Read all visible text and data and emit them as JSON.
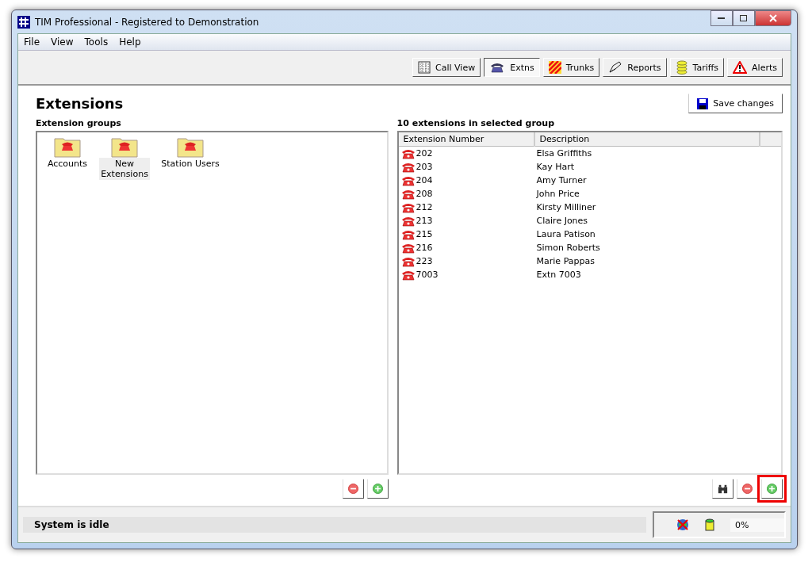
{
  "window": {
    "title": "TIM Professional - Registered to Demonstration"
  },
  "menu": [
    "File",
    "View",
    "Tools",
    "Help"
  ],
  "tabs": [
    {
      "label": "Call View",
      "kind": "grid",
      "selected": false
    },
    {
      "label": "Extns",
      "kind": "phone",
      "selected": true
    },
    {
      "label": "Trunks",
      "kind": "stripes",
      "selected": false
    },
    {
      "label": "Reports",
      "kind": "pen",
      "selected": false
    },
    {
      "label": "Tariffs",
      "kind": "coins",
      "selected": false
    },
    {
      "label": "Alerts",
      "kind": "warning",
      "selected": false
    }
  ],
  "page": {
    "title": "Extensions",
    "save_button": "Save changes"
  },
  "groups": {
    "label": "Extension groups",
    "items": [
      {
        "name": "Accounts",
        "selected": false
      },
      {
        "name": "New Extensions",
        "selected": true
      },
      {
        "name": "Station Users",
        "selected": false
      }
    ],
    "buttons": [
      {
        "kind": "remove",
        "highlighted": false
      },
      {
        "kind": "add",
        "highlighted": false
      }
    ]
  },
  "extensions": {
    "label": "10 extensions in selected group",
    "columns": [
      "Extension Number",
      "Description"
    ],
    "rows": [
      [
        "202",
        "Elsa Griffiths"
      ],
      [
        "203",
        "Kay Hart"
      ],
      [
        "204",
        "Amy Turner"
      ],
      [
        "208",
        "John Price"
      ],
      [
        "212",
        "Kirsty Milliner"
      ],
      [
        "213",
        "Claire Jones"
      ],
      [
        "215",
        "Laura Patison"
      ],
      [
        "216",
        "Simon Roberts"
      ],
      [
        "223",
        "Marie Pappas"
      ],
      [
        "7003",
        "Extn 7003"
      ]
    ],
    "buttons": [
      {
        "kind": "find",
        "highlighted": false
      },
      {
        "kind": "remove",
        "highlighted": false
      },
      {
        "kind": "add",
        "highlighted": true
      }
    ]
  },
  "status_bar": {
    "message": "System is idle",
    "usage": "0%"
  }
}
